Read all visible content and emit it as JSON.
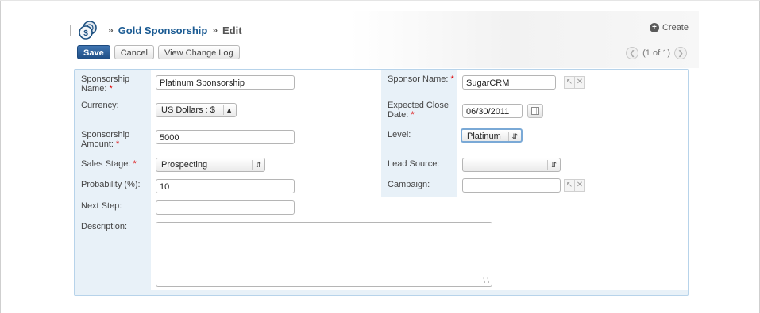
{
  "header": {
    "module_crumb": "Gold Sponsorship",
    "action_crumb": "Edit",
    "separator": "»",
    "create_label": "Create"
  },
  "toolbar": {
    "save_label": "Save",
    "cancel_label": "Cancel",
    "change_log_label": "View Change Log"
  },
  "pager": {
    "label": "(1 of 1)",
    "prev_icon": "chevron-left-icon",
    "next_icon": "chevron-right-icon"
  },
  "form": {
    "sponsorship_name": {
      "label": "Sponsorship Name:",
      "required": "*",
      "value": "Platinum Sponsorship"
    },
    "sponsor_name": {
      "label": "Sponsor Name:",
      "required": "*",
      "value": "SugarCRM"
    },
    "currency": {
      "label": "Currency:",
      "value": "US Dollars : $"
    },
    "expected_close": {
      "label": "Expected Close Date:",
      "required": "*",
      "value": "06/30/2011"
    },
    "amount": {
      "label": "Sponsorship Amount:",
      "required": "*",
      "value": "5000"
    },
    "level": {
      "label": "Level:",
      "value": "Platinum"
    },
    "sales_stage": {
      "label": "Sales Stage:",
      "required": "*",
      "value": "Prospecting"
    },
    "lead_source": {
      "label": "Lead Source:",
      "value": ""
    },
    "probability": {
      "label": "Probability (%):",
      "value": "10"
    },
    "campaign": {
      "label": "Campaign:",
      "value": ""
    },
    "next_step": {
      "label": "Next Step:",
      "value": ""
    },
    "description": {
      "label": "Description:",
      "value": ""
    }
  },
  "colors": {
    "primary_button": "#1f4f86",
    "link": "#1b5b93",
    "required": "#dd0000",
    "panel_bg": "#e8f1f8"
  }
}
